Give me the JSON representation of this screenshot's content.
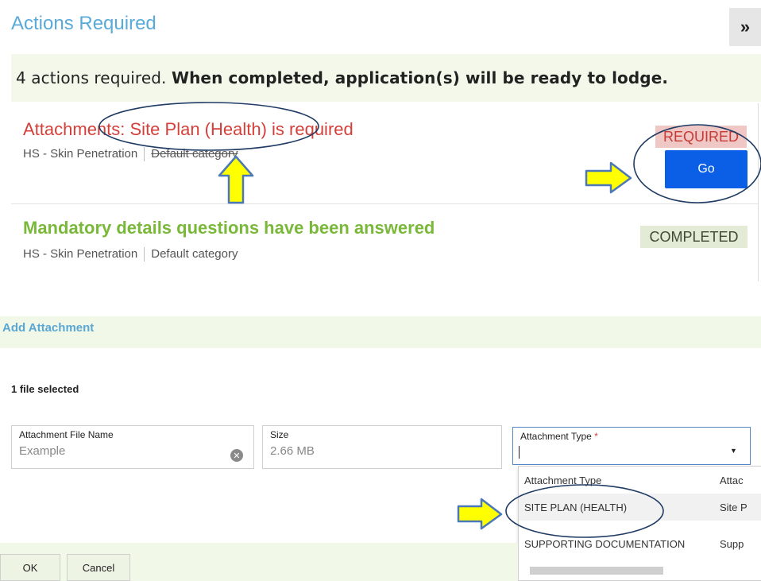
{
  "actions_panel": {
    "title": "Actions Required",
    "collapse_icon": "double-chevron-right-icon",
    "collapse_glyph": "»",
    "summary_prefix": "4 actions required. ",
    "summary_bold": "When completed, application(s) will be ready to lodge.",
    "items": [
      {
        "title": "Attachments: Site Plan (Health) is required",
        "meta_left": "HS - Skin Penetration",
        "meta_right": "Default category",
        "status": "REQUIRED",
        "button": "Go"
      },
      {
        "title": "Mandatory details questions have been answered",
        "meta_left": "HS - Skin Penetration",
        "meta_right": "Default category",
        "status": "COMPLETED"
      }
    ]
  },
  "add_attachment": {
    "title": "Add Attachment",
    "file_count": "1 file selected",
    "fields": {
      "name_label": "Attachment File Name",
      "name_value": "Example",
      "size_label": "Size",
      "size_value": "2.66 MB",
      "type_label": "Attachment Type",
      "type_required_mark": "*"
    },
    "dropdown": {
      "header_col1": "Attachment Type",
      "header_col2": "Attac",
      "options": [
        {
          "col1": "SITE PLAN (HEALTH)",
          "col2": "Site P"
        },
        {
          "col1": "SUPPORTING DOCUMENTATION",
          "col2": "Supp"
        }
      ]
    },
    "buttons": {
      "ok": "OK",
      "cancel": "Cancel"
    }
  },
  "colors": {
    "title_blue": "#5aaad8",
    "required_red": "#d53f3a",
    "completed_green": "#7ab83a",
    "go_blue": "#0a5fe6",
    "annotation_arrow_fill": "#ffff00",
    "annotation_arrow_stroke": "#4a78b8",
    "annotation_ellipse": "#1f3b63"
  }
}
